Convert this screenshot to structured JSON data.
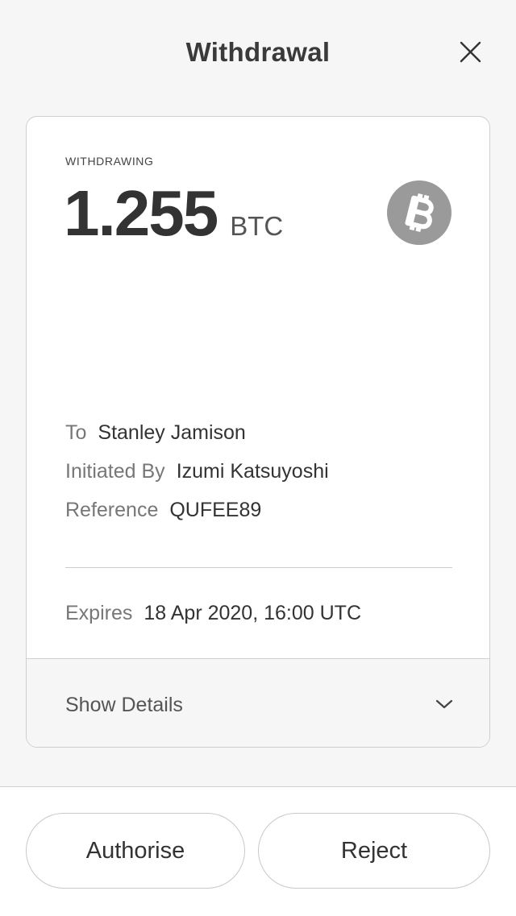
{
  "header": {
    "title": "Withdrawal"
  },
  "icons": {
    "close": "close-icon",
    "coin": "bitcoin-icon",
    "chevron": "chevron-down-icon"
  },
  "withdrawal": {
    "eyebrow": "WITHDRAWING",
    "amount": "1.255",
    "unit": "BTC",
    "coin_color": "#9a9a9a",
    "details": [
      {
        "label": "To",
        "value": "Stanley Jamison"
      },
      {
        "label": "Initiated By",
        "value": "Izumi Katsuyoshi"
      },
      {
        "label": "Reference",
        "value": "QUFEE89"
      }
    ],
    "expires": {
      "label": "Expires",
      "value": "18 Apr 2020, 16:00 UTC"
    },
    "show_details_label": "Show Details"
  },
  "actions": {
    "authorise_label": "Authorise",
    "reject_label": "Reject"
  }
}
